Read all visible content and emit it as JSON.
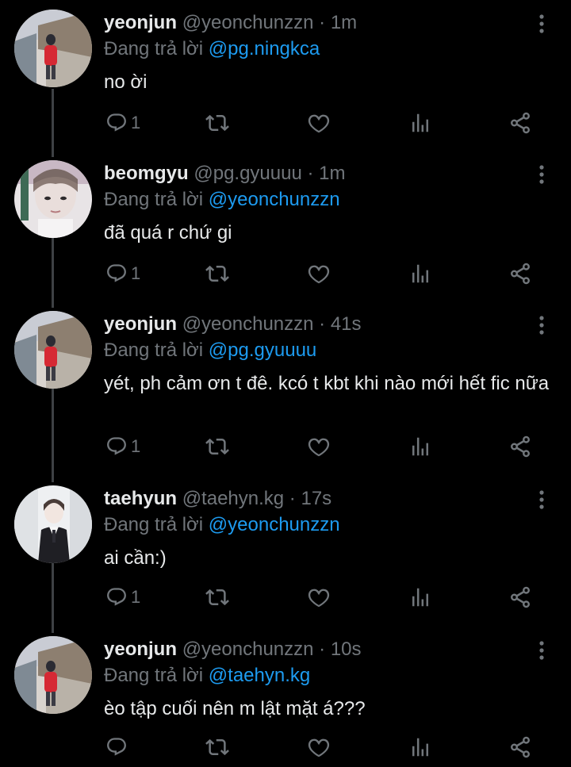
{
  "thread": {
    "reply_prefix": "Đang trả lời",
    "tweets": [
      {
        "name": "yeonjun",
        "handle": "@yeonchunzzn",
        "time": "1m",
        "reply_to": "@pg.ningkca",
        "text": "no ời",
        "reply_count": "1"
      },
      {
        "name": "beomgyu",
        "handle": "@pg.gyuuuu",
        "time": "1m",
        "reply_to": "@yeonchunzzn",
        "text": "đã quá r chứ gi",
        "reply_count": "1"
      },
      {
        "name": "yeonjun",
        "handle": "@yeonchunzzn",
        "time": "41s",
        "reply_to": "@pg.gyuuuu",
        "text": "yét, ph cảm ơn t đê. kcó t kbt khi nào mới hết fic nữa",
        "reply_count": "1"
      },
      {
        "name": "taehyun",
        "handle": "@taehyn.kg",
        "time": "17s",
        "reply_to": "@yeonchunzzn",
        "text": "ai cần:)",
        "reply_count": "1"
      },
      {
        "name": "yeonjun",
        "handle": "@yeonchunzzn",
        "time": "10s",
        "reply_to": "@taehyn.kg",
        "text": "èo tập cuối nên m lật mặt á???",
        "reply_count": ""
      }
    ]
  },
  "icons": {
    "reply": "reply-icon",
    "retweet": "retweet-icon",
    "like": "like-icon",
    "views": "views-icon",
    "share": "share-icon",
    "more": "more-icon"
  },
  "colors": {
    "background": "#000000",
    "text": "#e7e9ea",
    "muted": "#71767b",
    "mention": "#1d9bf0",
    "thread_line": "#3e4144"
  }
}
